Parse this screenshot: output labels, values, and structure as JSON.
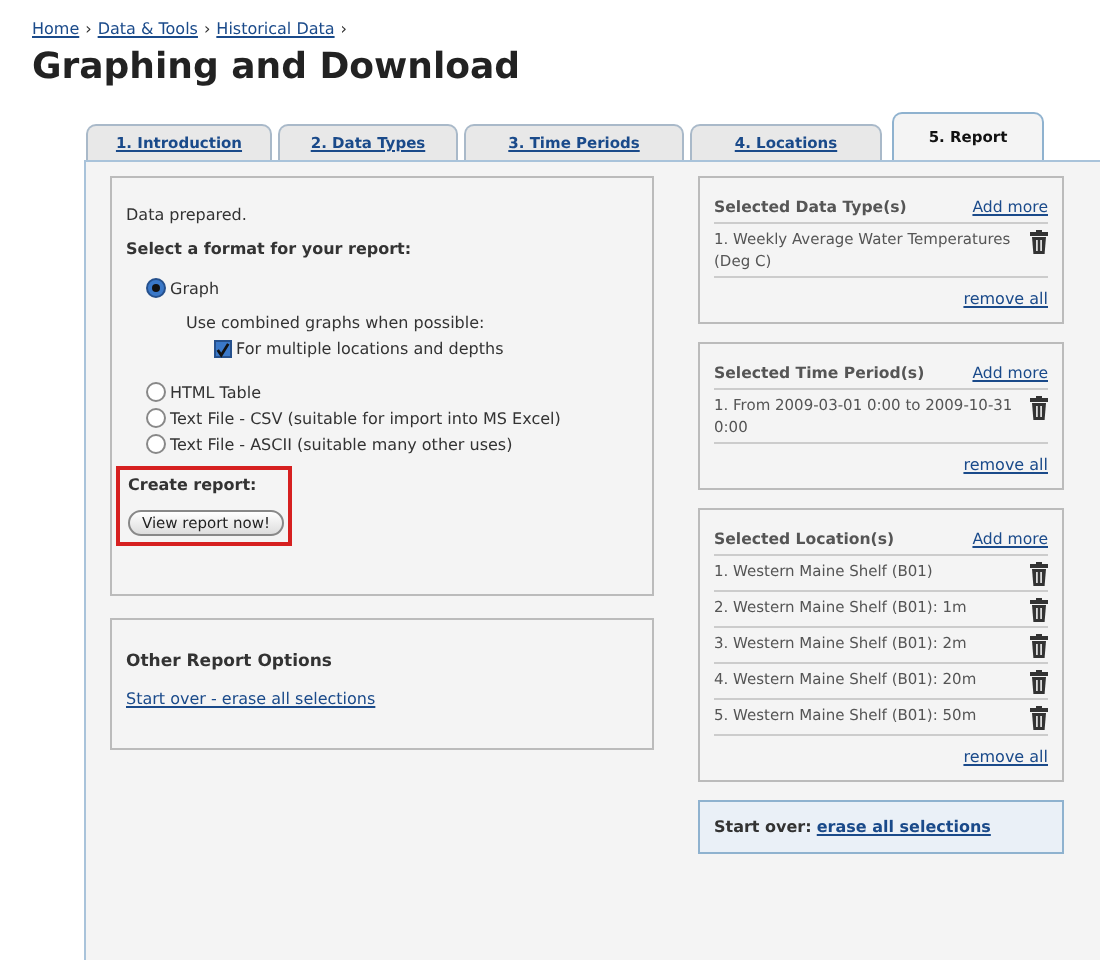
{
  "breadcrumb": [
    {
      "label": "Home"
    },
    {
      "label": "Data & Tools"
    },
    {
      "label": "Historical Data"
    }
  ],
  "breadcrumb_separator": "›",
  "title": "Graphing and Download",
  "tabs": [
    {
      "label": "1. Introduction",
      "selected": false
    },
    {
      "label": "2. Data Types",
      "selected": false
    },
    {
      "label": "3. Time Periods",
      "selected": false
    },
    {
      "label": "4. Locations",
      "selected": false
    },
    {
      "label": "5. Report",
      "selected": true
    }
  ],
  "report_box": {
    "status": "Data prepared.",
    "format_heading": "Select a format for your report:",
    "formats": [
      {
        "label": "Graph",
        "selected": true,
        "combined": {
          "hint": "Use combined graphs when possible:",
          "option": {
            "label": "For multiple locations and depths",
            "checked": true
          }
        }
      },
      {
        "label": "HTML Table",
        "selected": false
      },
      {
        "label": "Text File - CSV (suitable for import into MS Excel)",
        "selected": false
      },
      {
        "label": "Text File - ASCII (suitable many other uses)",
        "selected": false
      }
    ],
    "create_heading": "Create report:",
    "create_button": "View report now!",
    "highlighted": true
  },
  "other_options": {
    "heading": "Other Report Options",
    "link": "Start over - erase all selections"
  },
  "selections": [
    {
      "heading": "Selected Data Type(s)",
      "add_link": "Add more",
      "items": [
        "1. Weekly Average Water Temperatures (Deg C)"
      ],
      "remove_all": "remove all"
    },
    {
      "heading": "Selected Time Period(s)",
      "add_link": "Add more",
      "items": [
        "1. From 2009-03-01 0:00 to 2009-10-31 0:00"
      ],
      "remove_all": "remove all"
    },
    {
      "heading": "Selected Location(s)",
      "add_link": "Add more",
      "items": [
        "1. Western Maine Shelf (B01)",
        "2. Western Maine Shelf (B01): 1m",
        "3. Western Maine Shelf (B01): 2m",
        "4. Western Maine Shelf (B01): 20m",
        "5. Western Maine Shelf (B01): 50m"
      ],
      "remove_all": "remove all"
    }
  ],
  "start_over": {
    "label": "Start over:",
    "link": "erase all selections"
  }
}
